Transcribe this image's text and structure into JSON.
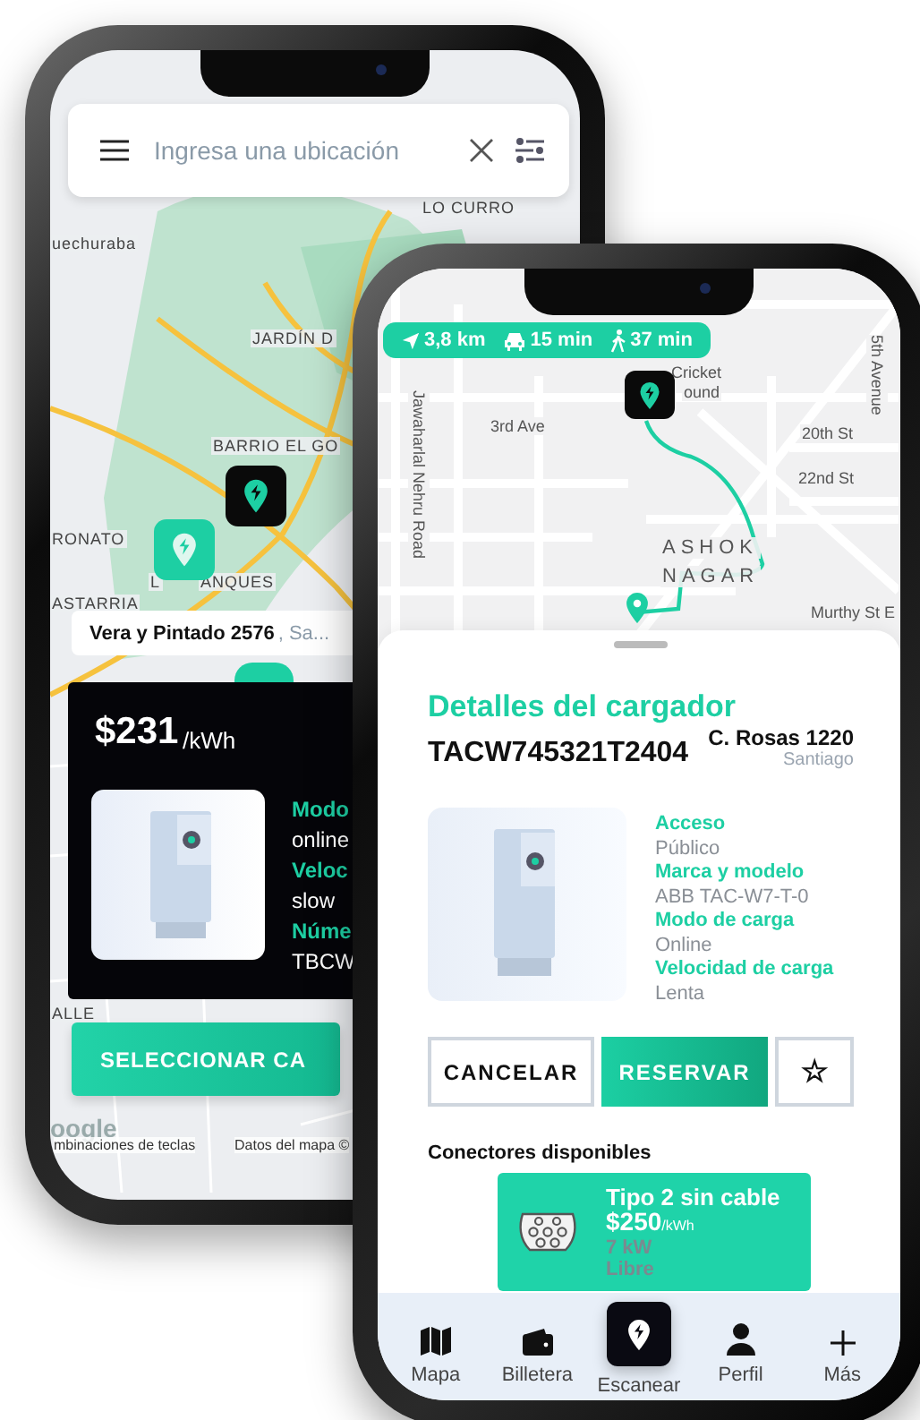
{
  "back_phone": {
    "search": {
      "placeholder": "Ingresa una ubicación"
    },
    "map_labels": [
      "LO CURRO",
      "uechuraba",
      "JARDÍN D",
      "BARRIO EL GO",
      "RONATO",
      "L",
      "ANQUES",
      "ASTARRIA",
      "ALLE"
    ],
    "place": {
      "name": "Vera y Pintado 2576",
      "suffix": ", Sa..."
    },
    "card": {
      "price": "$231",
      "unit": "/kWh",
      "specs": [
        {
          "label": "Modo",
          "value": "online"
        },
        {
          "label": "Veloc",
          "value": "slow"
        },
        {
          "label": "Núme",
          "value": "TBCW"
        }
      ]
    },
    "select_button": "SELECCIONAR CA",
    "footer": {
      "logo": "oogle",
      "shortcuts": "mbinaciones de teclas",
      "map_data": "Datos del mapa ©"
    }
  },
  "front_phone": {
    "trip": [
      {
        "kind": "distance",
        "text": "3,8 km"
      },
      {
        "kind": "car",
        "text": "15 min"
      },
      {
        "kind": "walk",
        "text": "37 min"
      }
    ],
    "map_labels": [
      "Cricket",
      "ound",
      "3rd Ave",
      "20th St",
      "22nd St",
      "5th Avenue",
      "Jawaharlal Nehru Road",
      "ASHOK",
      "NAGAR",
      "Murthy St E"
    ],
    "details": {
      "title": "Detalles del cargador",
      "code": "TACW745321T2404",
      "address": "C. Rosas 1220",
      "city": "Santiago",
      "specs": [
        {
          "label": "Acceso",
          "value": "Público"
        },
        {
          "label": "Marca y modelo",
          "value": "ABB TAC-W7-T-0"
        },
        {
          "label": "Modo de carga",
          "value": "Online"
        },
        {
          "label": "Velocidad de carga",
          "value": "Lenta"
        }
      ]
    },
    "buttons": {
      "cancel": "CANCELAR",
      "reserve": "RESERVAR",
      "favorite": "☆"
    },
    "connectors_title": "Conectores disponibles",
    "connectors": [
      {
        "name": "Tipo 2 sin cable",
        "price": "$250",
        "unit": "/kWh",
        "power": "7 kW",
        "status": "Libre"
      }
    ],
    "nav": [
      {
        "kind": "map",
        "label": "Mapa"
      },
      {
        "kind": "wallet",
        "label": "Billetera"
      },
      {
        "kind": "scan",
        "label": "Escanear"
      },
      {
        "kind": "profile",
        "label": "Perfil"
      },
      {
        "kind": "add",
        "label": "Más"
      }
    ]
  }
}
